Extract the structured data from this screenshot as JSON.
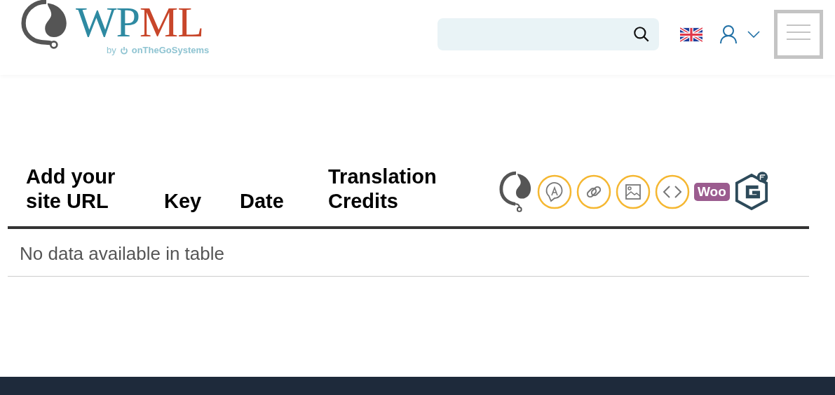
{
  "header": {
    "logo": {
      "parts": [
        {
          "text": "WP",
          "color": "#2e8aa2"
        },
        {
          "text": "ML",
          "color": "#c8462a"
        }
      ],
      "by": "by",
      "company": "onTheGoSystems"
    }
  },
  "table": {
    "columns": [
      {
        "label": "Add your site URL"
      },
      {
        "label": "Key"
      },
      {
        "label": "Date"
      },
      {
        "label": "Translation Credits"
      },
      {
        "kind": "icons",
        "icons": [
          {
            "kind": "wpml"
          },
          {
            "kind": "string"
          },
          {
            "kind": "link"
          },
          {
            "kind": "media"
          },
          {
            "kind": "code"
          },
          {
            "kind": "woo",
            "text": "Woo"
          },
          {
            "kind": "gravity"
          }
        ]
      }
    ],
    "empty_message": "No data available in table"
  }
}
